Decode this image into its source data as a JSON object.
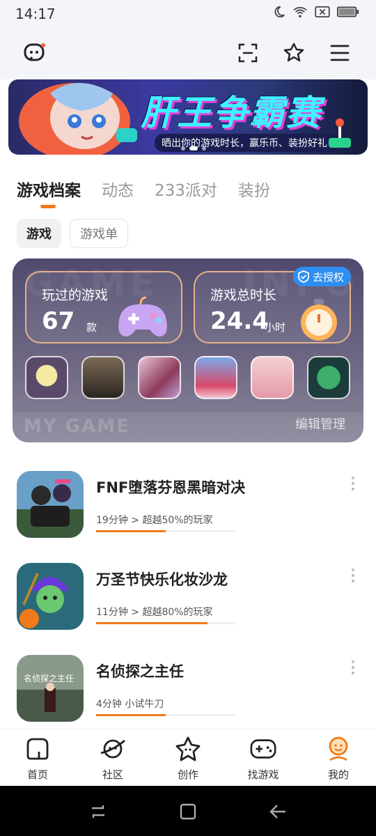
{
  "status_bar": {
    "time": "14:17"
  },
  "banner": {
    "title": "肝王争霸赛",
    "subtitle": "晒出你的游戏时长，赢乐币、装扮好礼！"
  },
  "tabs": [
    {
      "label": "游戏档案",
      "active": true
    },
    {
      "label": "动态",
      "active": false
    },
    {
      "label": "233派对",
      "active": false
    },
    {
      "label": "装扮",
      "active": false
    }
  ],
  "chips": [
    {
      "label": "游戏",
      "active": true
    },
    {
      "label": "游戏单",
      "active": false
    }
  ],
  "mygame": {
    "played_label": "玩过的游戏",
    "played_value": "67",
    "played_unit": "款",
    "duration_label": "游戏总时长",
    "duration_value": "24.4",
    "duration_unit": "小时",
    "auth_badge": "去授权",
    "footer_text": "MY GAME",
    "edit_label": "编辑管理"
  },
  "games": [
    {
      "name": "FNF堕落芬恩黑暗对决",
      "meta": "19分钟 > 超越50%的玩家",
      "progress": 0.5
    },
    {
      "name": "万圣节快乐化妆沙龙",
      "meta": "11分钟 > 超越80%的玩家",
      "progress": 0.8
    },
    {
      "name": "名侦探之主任",
      "meta": "4分钟 小试牛刀",
      "progress": 0.5
    }
  ],
  "bottom_nav": [
    {
      "label": "首页",
      "icon": "home-icon"
    },
    {
      "label": "社区",
      "icon": "planet-icon"
    },
    {
      "label": "创作",
      "icon": "star-icon"
    },
    {
      "label": "找游戏",
      "icon": "gamepad-icon"
    },
    {
      "label": "我的",
      "icon": "profile-icon"
    }
  ],
  "colors": {
    "accent": "#f07a1a",
    "badge": "#2f8ff0"
  }
}
